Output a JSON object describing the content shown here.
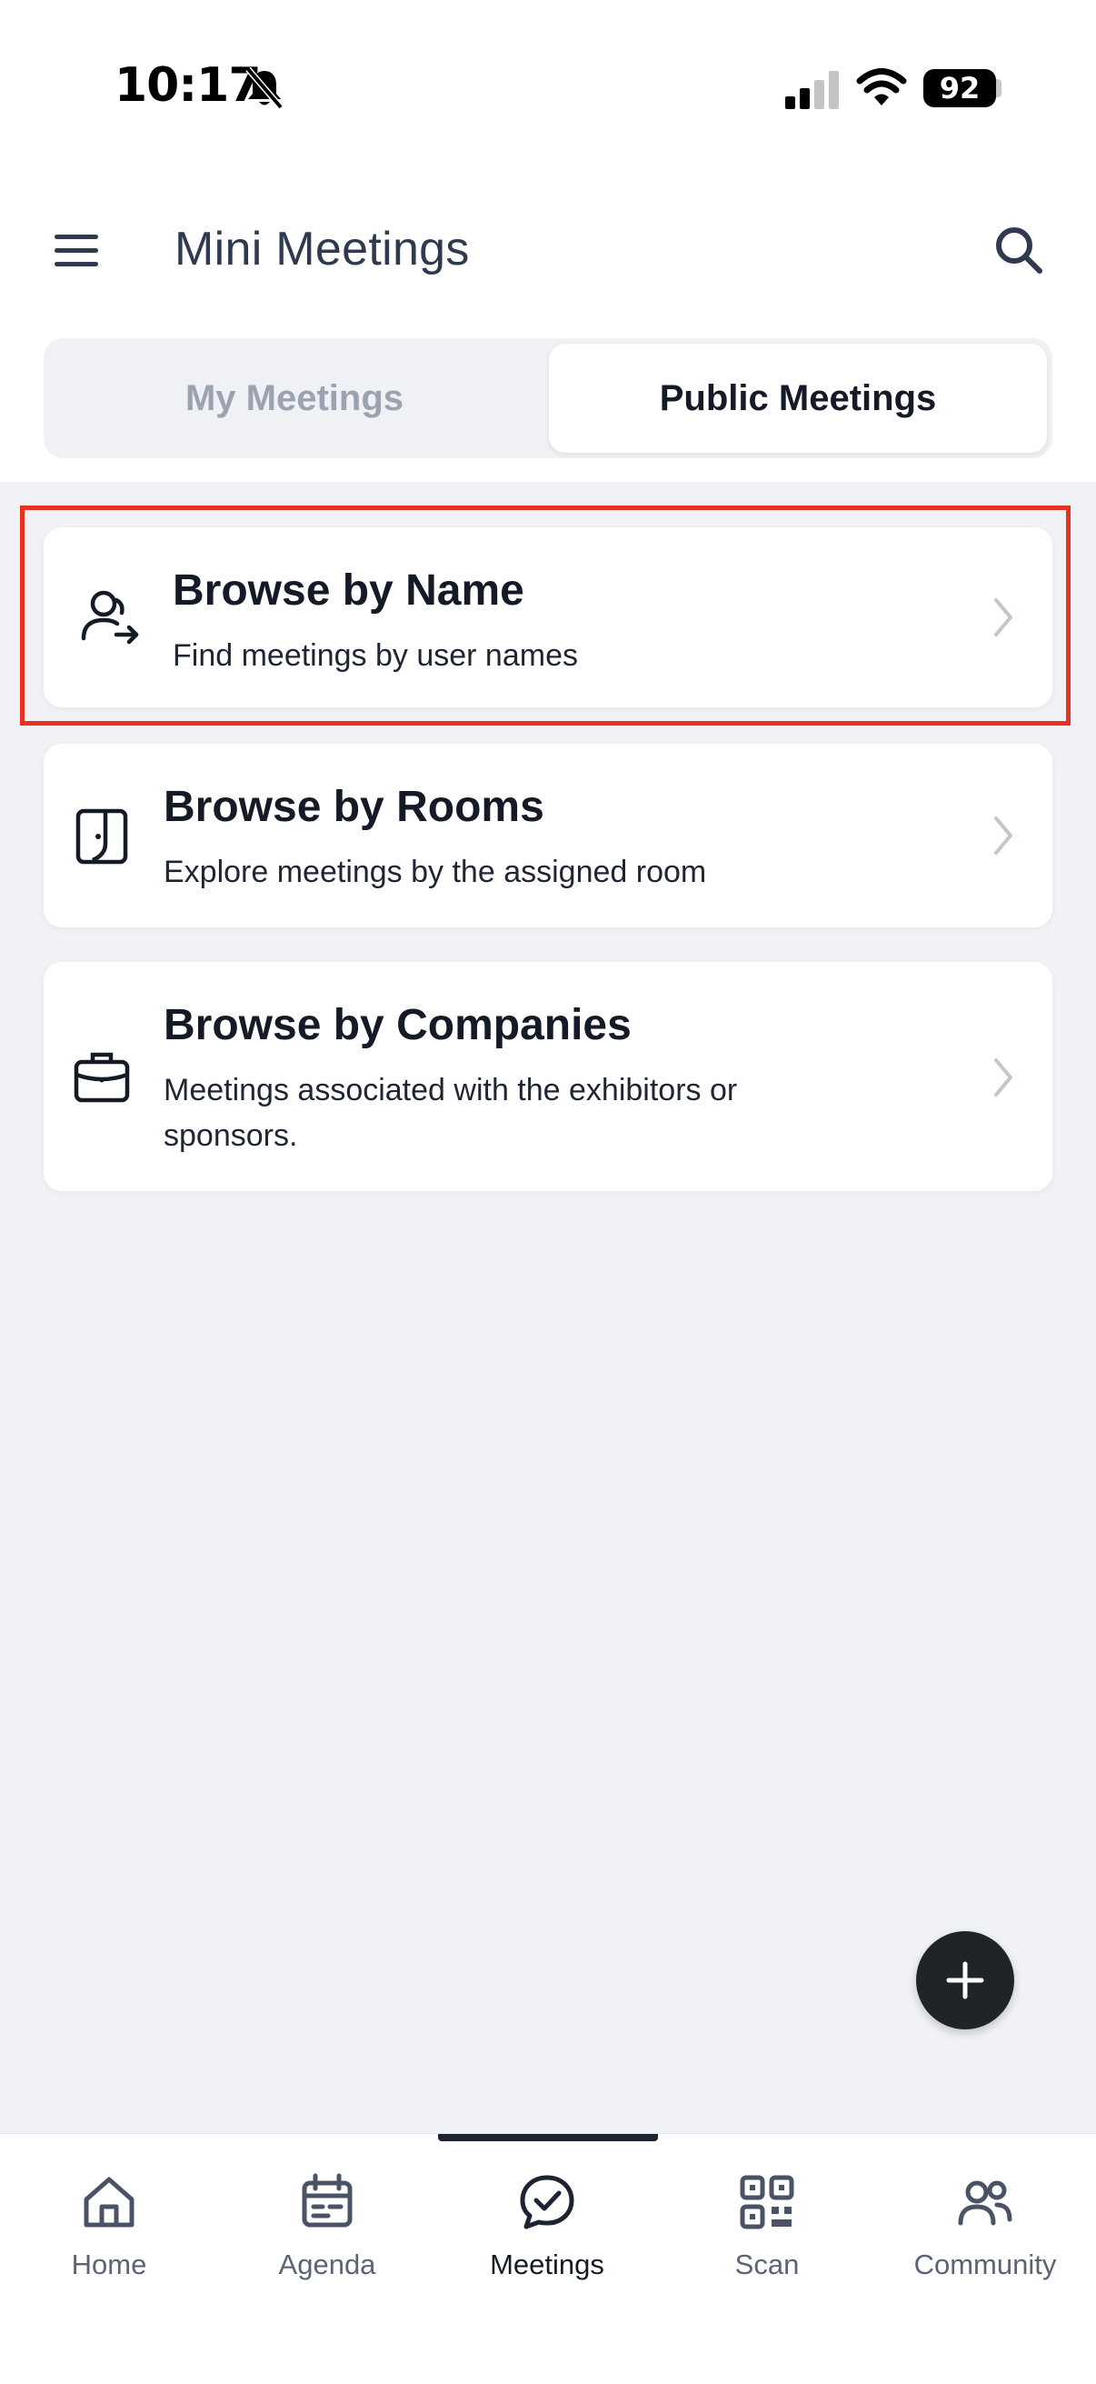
{
  "status_bar": {
    "time": "10:17",
    "battery": "92"
  },
  "header": {
    "title": "Mini Meetings",
    "menu_icon": "hamburger-menu-icon",
    "search_icon": "search-icon"
  },
  "tabs": [
    {
      "label": "My Meetings",
      "selected": false
    },
    {
      "label": "Public Meetings",
      "selected": true
    }
  ],
  "browse_options": [
    {
      "title": "Browse by Name",
      "subtitle": "Find meetings by user names",
      "icon": "user-arrow-icon",
      "highlighted": true
    },
    {
      "title": "Browse by Rooms",
      "subtitle": "Explore meetings by the assigned room",
      "icon": "door-icon",
      "highlighted": false
    },
    {
      "title": "Browse by Companies",
      "subtitle_line1": "Meetings associated with the exhibitors or",
      "subtitle_line2": "sponsors.",
      "icon": "briefcase-icon",
      "highlighted": false
    }
  ],
  "fab": {
    "icon": "plus-icon"
  },
  "bottom_nav": [
    {
      "label": "Home",
      "icon": "home-icon",
      "active": false
    },
    {
      "label": "Agenda",
      "icon": "calendar-icon",
      "active": false
    },
    {
      "label": "Meetings",
      "icon": "meetings-check-icon",
      "active": true
    },
    {
      "label": "Scan",
      "icon": "qr-code-icon",
      "active": false
    },
    {
      "label": "Community",
      "icon": "community-icon",
      "active": false
    }
  ],
  "colors": {
    "highlight": "#e8311f",
    "background": "#f1f2f6",
    "text_primary": "#141a26",
    "text_muted": "#9ba3b1",
    "fab": "#1f2429"
  }
}
